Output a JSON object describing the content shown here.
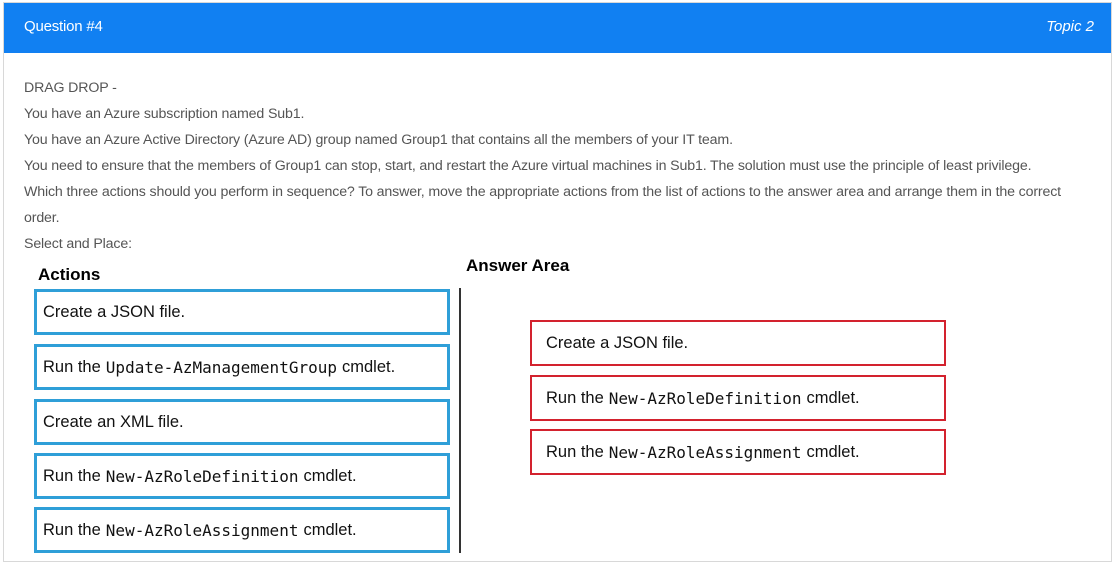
{
  "header": {
    "question": "Question #4",
    "topic": "Topic 2"
  },
  "body": {
    "lines": [
      "DRAG DROP -",
      "You have an Azure subscription named Sub1.",
      "You have an Azure Active Directory (Azure AD) group named Group1 that contains all the members of your IT team.",
      "You need to ensure that the members of Group1 can stop, start, and restart the Azure virtual machines in Sub1. The solution must use the principle of least privilege.",
      "Which three actions should you perform in sequence? To answer, move the appropriate actions from the list of actions to the answer area and arrange them in the correct order.",
      "Select and Place:"
    ]
  },
  "actions": {
    "title": "Actions",
    "items": [
      {
        "pre": "Create a JSON file.",
        "code": "",
        "post": ""
      },
      {
        "pre": "Run the",
        "code": "Update-AzManagementGroup",
        "post": "cmdlet."
      },
      {
        "pre": "Create an XML file.",
        "code": "",
        "post": ""
      },
      {
        "pre": "Run the",
        "code": "New-AzRoleDefinition",
        "post": "cmdlet."
      },
      {
        "pre": "Run the",
        "code": "New-AzRoleAssignment",
        "post": "cmdlet."
      }
    ]
  },
  "answer": {
    "title": "Answer Area",
    "items": [
      {
        "pre": "Create a JSON file.",
        "code": "",
        "post": ""
      },
      {
        "pre": "Run the",
        "code": "New-AzRoleDefinition",
        "post": "cmdlet."
      },
      {
        "pre": "Run the",
        "code": "New-AzRoleAssignment",
        "post": "cmdlet."
      }
    ]
  },
  "colors": {
    "header": "#1180f2",
    "action_border": "#2f9fd8",
    "answer_border": "#d3222e"
  }
}
